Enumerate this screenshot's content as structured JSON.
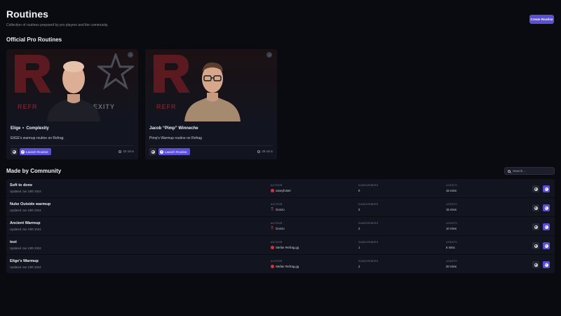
{
  "header": {
    "title": "Routines",
    "subtitle": "Collection of routines prepared by pro players and the community.",
    "create_button": "Create Routine"
  },
  "colors": {
    "background": "#0a0b10",
    "card": "#121520",
    "accent": "#5b4fd6",
    "brand_red": "#7a1f27"
  },
  "pro_section": {
    "title": "Official Pro Routines",
    "cards": [
      {
        "player": "Elige",
        "team": "Complexity",
        "description": "EliGE's warmup routine on Refrag.",
        "launch_label": "Launch Routine",
        "duration": "30 mins",
        "hero_left_text": "REFR",
        "hero_right_text": "EXITY",
        "icons": [
          "arrow-right-icon",
          "gear-icon",
          "play-icon",
          "clock-icon"
        ]
      },
      {
        "player": "Jacob “Pimp” Winneche",
        "team": "",
        "description": "Pimp's Warmup routine on Refrag",
        "launch_label": "Launch Routine",
        "duration": "39 mins",
        "hero_left_text": "REFR",
        "hero_right_text": "",
        "icons": [
          "arrow-right-icon",
          "gear-icon",
          "play-icon",
          "clock-icon"
        ]
      }
    ]
  },
  "community_section": {
    "title": "Made by Community",
    "search_placeholder": "Search...",
    "column_labels": {
      "author": "AUTHOR",
      "subscribers": "SUBSCRIBERS",
      "length": "LENGTH"
    },
    "rows": [
      {
        "name": "Soft to done",
        "updated": "Updated Jun 19th 2024",
        "author": "caseyfoster",
        "avatar": "red",
        "subscribers": "0",
        "length": "15 mins"
      },
      {
        "name": "Nuke Outside warmup",
        "updated": "Updated Jun 19th 2024",
        "author": "Gonzo",
        "avatar": "t",
        "subscribers": "2",
        "length": "15 mins"
      },
      {
        "name": "Ancient Warmup",
        "updated": "Updated Jun 19th 2024",
        "author": "Gonzo",
        "avatar": "t",
        "subscribers": "2",
        "length": "10 mins"
      },
      {
        "name": "test",
        "updated": "Updated Jun 19th 2024",
        "author": "Stefan #refrag.gg",
        "avatar": "red",
        "subscribers": "1",
        "length": "5 mins"
      },
      {
        "name": "Elige's Warmup",
        "updated": "Updated Jun 19th 2024",
        "author": "Stefan #refrag.gg",
        "avatar": "red",
        "subscribers": "2",
        "length": "20 mins"
      }
    ]
  }
}
